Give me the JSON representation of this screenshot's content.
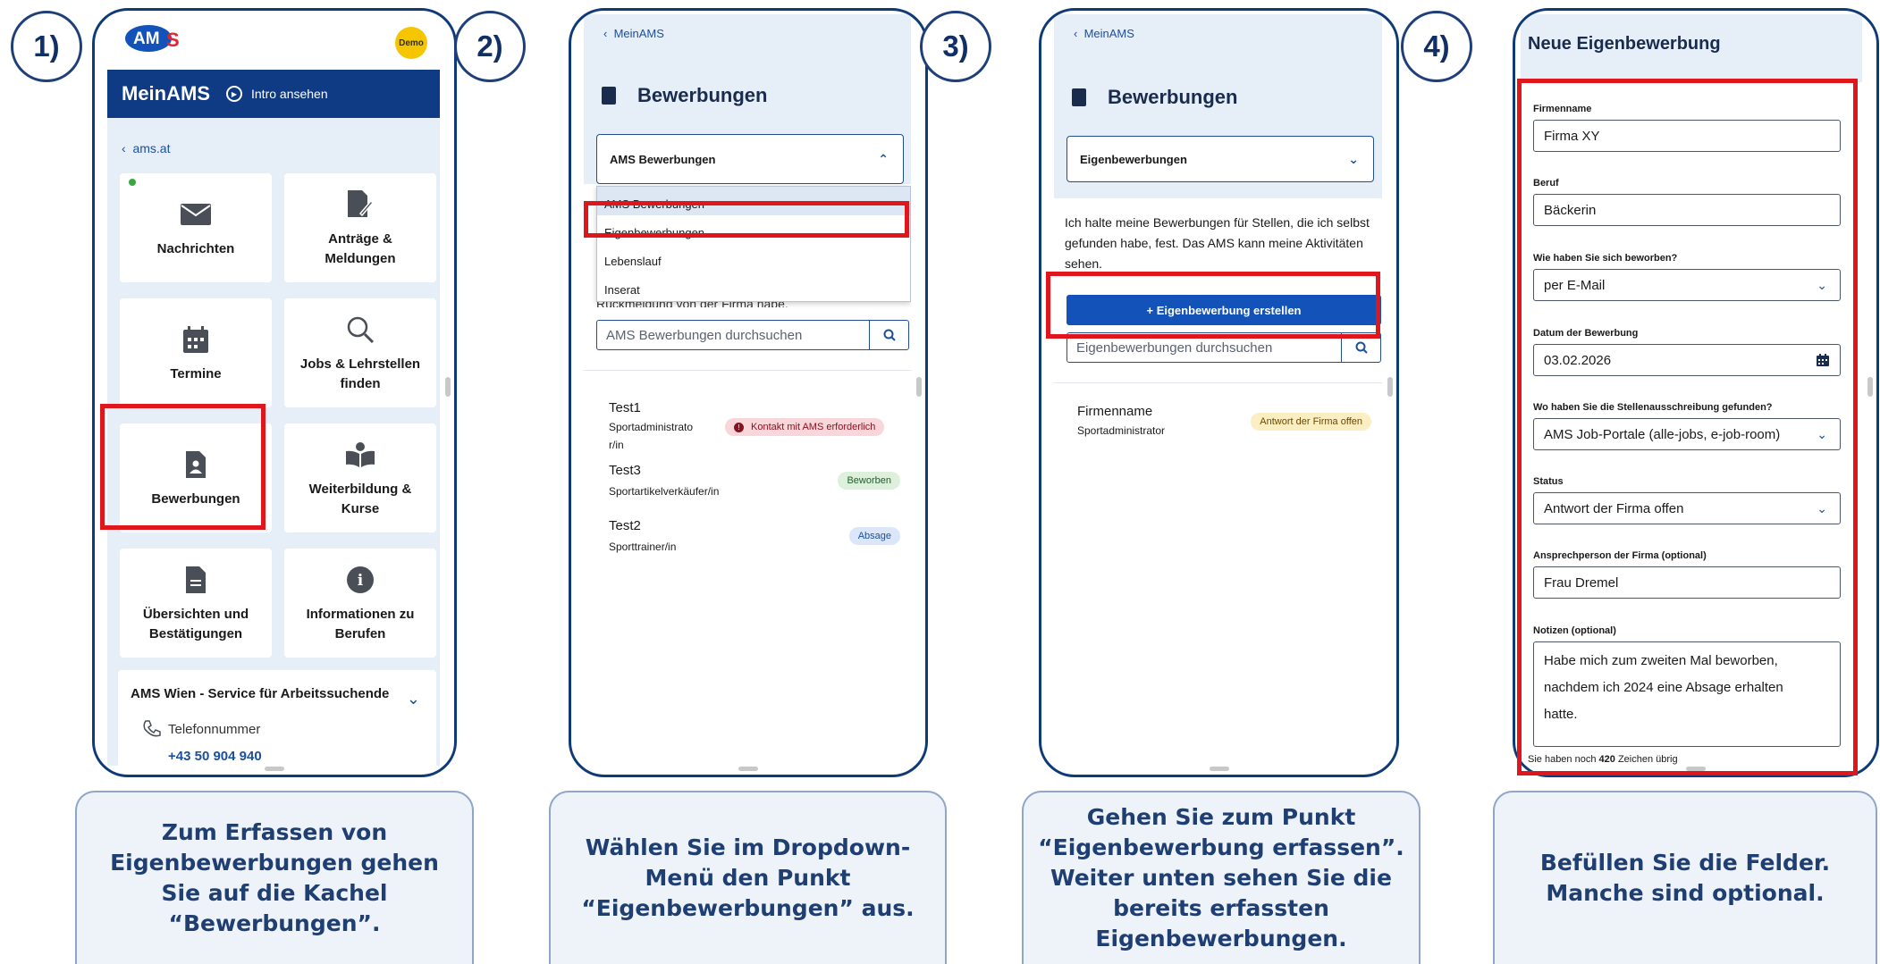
{
  "steps": [
    "1)",
    "2)",
    "3)",
    "4)"
  ],
  "captions": [
    "Zum Erfassen von Eigenbewerbungen gehen Sie auf die Kachel “Bewerbungen”.",
    "Wählen Sie im Dropdown-Menü den Punkt “Eigenbewerbungen” aus.",
    "Gehen Sie zum Punkt “Eigenbewerbung erfassen”. Weiter unten sehen Sie die bereits erfassten Eigenbewerbungen.",
    "Befüllen Sie die Felder. Manche sind optional."
  ],
  "panel1": {
    "logo_a": "AM",
    "logo_b": "S",
    "demo": "Demo",
    "bar_title": "MeinAMS",
    "intro": "Intro ansehen",
    "back": "ams.at",
    "tiles": [
      "Nachrichten",
      "Anträge & Meldungen",
      "Termine",
      "Jobs & Lehrstellen finden",
      "Bewerbungen",
      "Weiterbildung & Kurse",
      "Übersichten und Bestätigungen",
      "Informationen zu Berufen"
    ],
    "service_title": "AMS Wien - Service für Arbeitssuchende",
    "phone_label": "Telefonnummer",
    "phone": "+43 50 904 940"
  },
  "panel2": {
    "back": "MeinAMS",
    "title": "Bewerbungen",
    "select_value": "AMS Bewerbungen",
    "options": [
      "AMS Bewerbungen",
      "Eigenbewerbungen",
      "Lebenslauf",
      "Inserat"
    ],
    "hidden_text": "Rückmeldung von der Firma habe.",
    "search_placeholder": "AMS Bewerbungen durchsuchen",
    "rows": [
      {
        "title": "Test1",
        "sub1": "Sportadministrato",
        "sub2": "r/in",
        "badge": "Kontakt mit AMS erforderlich"
      },
      {
        "title": "Test3",
        "sub1": "Sportartikelverkäufer/in",
        "badge": "Beworben"
      },
      {
        "title": "Test2",
        "sub1": "Sporttrainer/in",
        "badge": "Absage"
      }
    ]
  },
  "panel3": {
    "back": "MeinAMS",
    "title": "Bewerbungen",
    "select_value": "Eigenbewerbungen",
    "info": "Ich halte meine Bewerbungen für Stellen, die ich selbst gefunden habe, fest. Das AMS kann meine Aktivitäten sehen.",
    "create_btn": "+ Eigenbewerbung erstellen",
    "search_placeholder": "Eigenbewerbungen durchsuchen",
    "row_title": "Firmenname",
    "row_sub": "Sportadministrator",
    "row_badge": "Antwort der Firma offen"
  },
  "panel4": {
    "title": "Neue Eigenbewerbung",
    "fields": [
      {
        "label": "Firmenname",
        "value": "Firma XY"
      },
      {
        "label": "Beruf",
        "value": "Bäckerin"
      },
      {
        "label": "Wie haben Sie sich beworben?",
        "value": "per E-Mail"
      },
      {
        "label": "Datum der Bewerbung",
        "value": "03.02.2026"
      },
      {
        "label": "Wo haben Sie die Stellenausschreibung gefunden?",
        "value": "AMS Job-Portale (alle-jobs, e-job-room)"
      },
      {
        "label": "Status",
        "value": "Antwort der Firma offen"
      },
      {
        "label": "Ansprechperson der Firma (optional)",
        "value": "Frau Dremel"
      }
    ],
    "notes_label": "Notizen (optional)",
    "notes_lines": [
      "Habe mich zum zweiten Mal beworben,",
      "nachdem ich 2024 eine Absage erhalten",
      "hatte."
    ],
    "remaining_pre": "Sie haben noch",
    "remaining_count": "420",
    "remaining_post": "Zeichen übrig"
  },
  "colors": {
    "navy": "#0f3a84",
    "red_highlight": "#e0161d",
    "primary_button": "#1352b8",
    "caption_bg": "#eef3fa"
  }
}
